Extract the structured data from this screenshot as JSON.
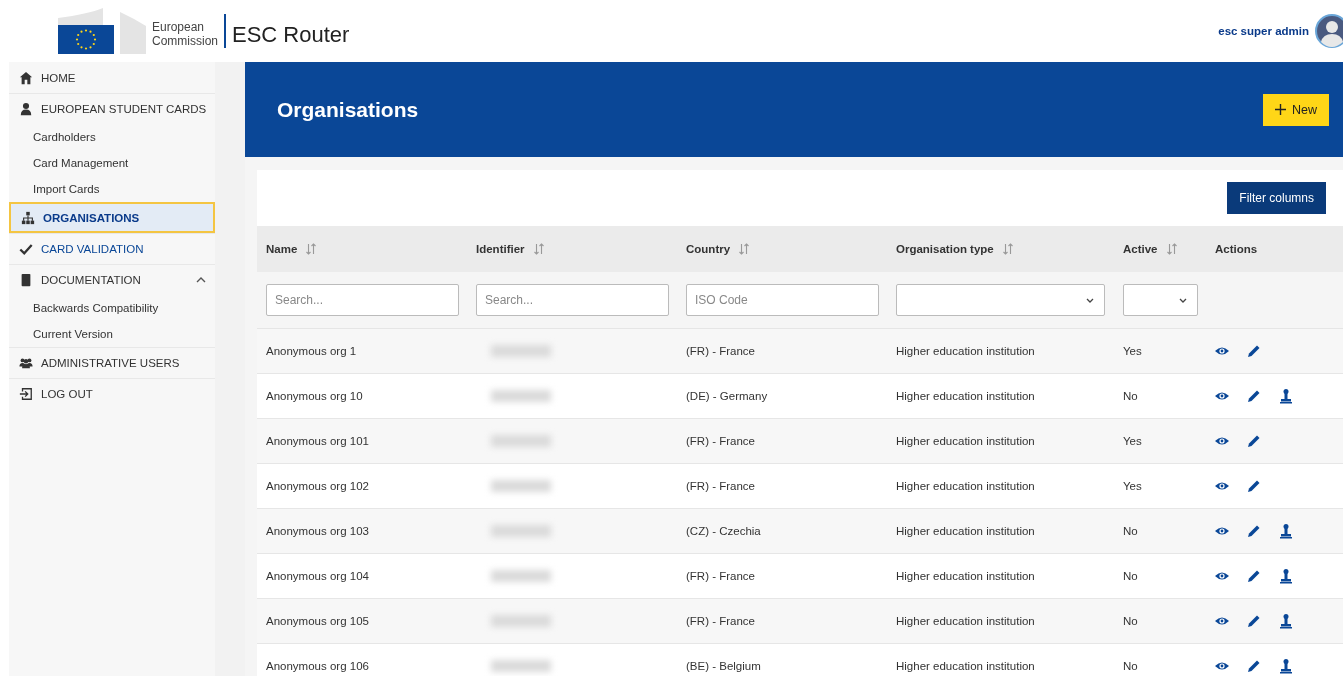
{
  "header": {
    "logo_top": "European",
    "logo_bottom": "Commission",
    "app_title": "ESC Router",
    "user": "esc super admin"
  },
  "sidebar": {
    "items": [
      {
        "label": "HOME",
        "selected": false
      },
      {
        "label": "EUROPEAN STUDENT CARDS",
        "selected": false,
        "expanded": true,
        "children": [
          {
            "label": "Cardholders"
          },
          {
            "label": "Card Management"
          },
          {
            "label": "Import Cards"
          }
        ]
      },
      {
        "label": "ORGANISATIONS",
        "selected": true
      },
      {
        "label": "CARD VALIDATION",
        "selected": false
      },
      {
        "label": "DOCUMENTATION",
        "selected": false,
        "expanded": true,
        "children": [
          {
            "label": "Backwards Compatibility"
          },
          {
            "label": "Current Version"
          }
        ]
      },
      {
        "label": "ADMINISTRATIVE USERS",
        "selected": false
      },
      {
        "label": "LOG OUT",
        "selected": false
      }
    ]
  },
  "page": {
    "title": "Organisations",
    "new_button": "New",
    "filter_button": "Filter columns"
  },
  "table": {
    "columns": [
      {
        "label": "Name",
        "sortable": true,
        "filter": {
          "kind": "text",
          "placeholder": "Search..."
        }
      },
      {
        "label": "Identifier",
        "sortable": true,
        "filter": {
          "kind": "text",
          "placeholder": "Search..."
        }
      },
      {
        "label": "Country",
        "sortable": true,
        "filter": {
          "kind": "text",
          "placeholder": "ISO Code"
        }
      },
      {
        "label": "Organisation type",
        "sortable": true,
        "filter": {
          "kind": "select"
        }
      },
      {
        "label": "Active",
        "sortable": true,
        "filter": {
          "kind": "select"
        }
      },
      {
        "label": "Actions",
        "sortable": false,
        "filter": {
          "kind": "none"
        }
      }
    ],
    "rows": [
      {
        "name": "Anonymous org 1",
        "country": "(FR) - France",
        "type": "Higher education institution",
        "active": "Yes",
        "stamp_action": false
      },
      {
        "name": "Anonymous org 10",
        "country": "(DE) - Germany",
        "type": "Higher education institution",
        "active": "No",
        "stamp_action": true
      },
      {
        "name": "Anonymous org 101",
        "country": "(FR) - France",
        "type": "Higher education institution",
        "active": "Yes",
        "stamp_action": false
      },
      {
        "name": "Anonymous org 102",
        "country": "(FR) - France",
        "type": "Higher education institution",
        "active": "Yes",
        "stamp_action": false
      },
      {
        "name": "Anonymous org 103",
        "country": "(CZ) - Czechia",
        "type": "Higher education institution",
        "active": "No",
        "stamp_action": true
      },
      {
        "name": "Anonymous org 104",
        "country": "(FR) - France",
        "type": "Higher education institution",
        "active": "No",
        "stamp_action": true
      },
      {
        "name": "Anonymous org 105",
        "country": "(FR) - France",
        "type": "Higher education institution",
        "active": "No",
        "stamp_action": true
      },
      {
        "name": "Anonymous org 106",
        "country": "(BE) - Belgium",
        "type": "Higher education institution",
        "active": "No",
        "stamp_action": true
      }
    ]
  }
}
